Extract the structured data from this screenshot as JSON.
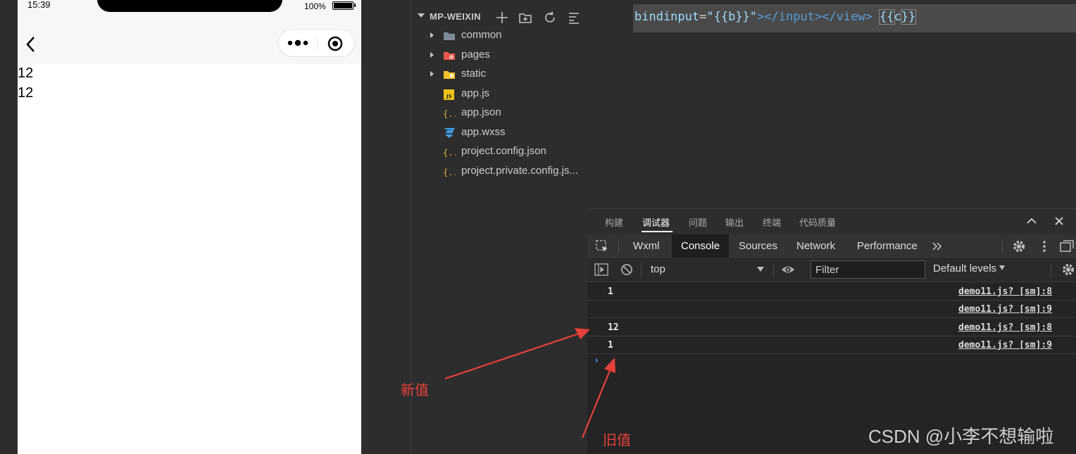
{
  "simulator": {
    "time": "15:39",
    "battery_text": "100%",
    "battery_level": 1.0,
    "page_lines": [
      "12",
      "12"
    ]
  },
  "explorer": {
    "project_title": "MP-WEIXIN",
    "items": [
      {
        "name": "common",
        "type": "folder",
        "icon": "folder-icon"
      },
      {
        "name": "pages",
        "type": "folder",
        "icon": "pages-folder-icon"
      },
      {
        "name": "static",
        "type": "folder",
        "icon": "static-folder-icon"
      },
      {
        "name": "app.js",
        "type": "file",
        "icon": "js-file-icon"
      },
      {
        "name": "app.json",
        "type": "file",
        "icon": "json-file-icon"
      },
      {
        "name": "app.wxss",
        "type": "file",
        "icon": "css-file-icon"
      },
      {
        "name": "project.config.json",
        "type": "file",
        "icon": "json-file-icon"
      },
      {
        "name": "project.private.config.js...",
        "type": "file",
        "icon": "json-file-icon"
      }
    ]
  },
  "editor": {
    "attr": "bindinput",
    "eq": "=",
    "value": "\"{{b}}\"",
    "tags": "></input></view>",
    "space": " ",
    "brace_open": "{{",
    "var": "c",
    "brace_close": "}}"
  },
  "devtools": {
    "panel_tabs": [
      "构建",
      "调试器",
      "问题",
      "输出",
      "终端",
      "代码质量"
    ],
    "active_panel_tab": "调试器",
    "tabs": [
      "Wxml",
      "Console",
      "Sources",
      "Network",
      "Performance"
    ],
    "active_tab": "Console",
    "context": "top",
    "filter_placeholder": "Filter",
    "levels": "Default levels",
    "logs": [
      {
        "value": "1",
        "source": "demo11.js? [sm]:8"
      },
      {
        "value": "",
        "source": "demo11.js? [sm]:9"
      },
      {
        "value": "12",
        "source": "demo11.js? [sm]:8"
      },
      {
        "value": "1",
        "source": "demo11.js? [sm]:9"
      }
    ]
  },
  "annotations": {
    "new_value": "新值",
    "old_value": "旧值",
    "color": "#e8413b"
  },
  "watermark": "CSDN @小李不想输啦"
}
